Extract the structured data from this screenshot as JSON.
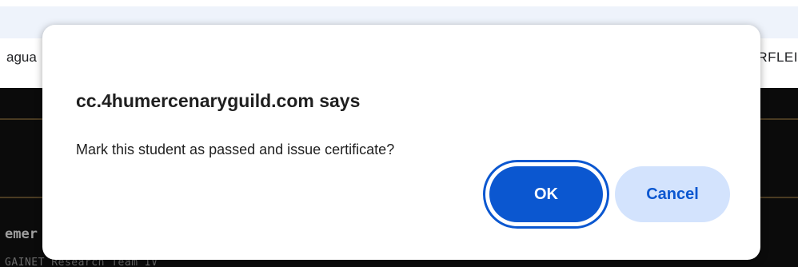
{
  "background": {
    "left_fragment": "agua",
    "right_fragment": "RFLEI",
    "heading_fragment": "emer",
    "subtext_fragment": "GAINET Research Team IV"
  },
  "dialog": {
    "title": "cc.4humercenaryguild.com says",
    "message": "Mark this student as passed and issue certificate?",
    "ok_label": "OK",
    "cancel_label": "Cancel"
  },
  "colors": {
    "primary": "#0b57d0",
    "secondary_bg": "#d3e3fd",
    "browser_bar": "#eef3fb",
    "dark_bg": "#0b0b0b"
  }
}
